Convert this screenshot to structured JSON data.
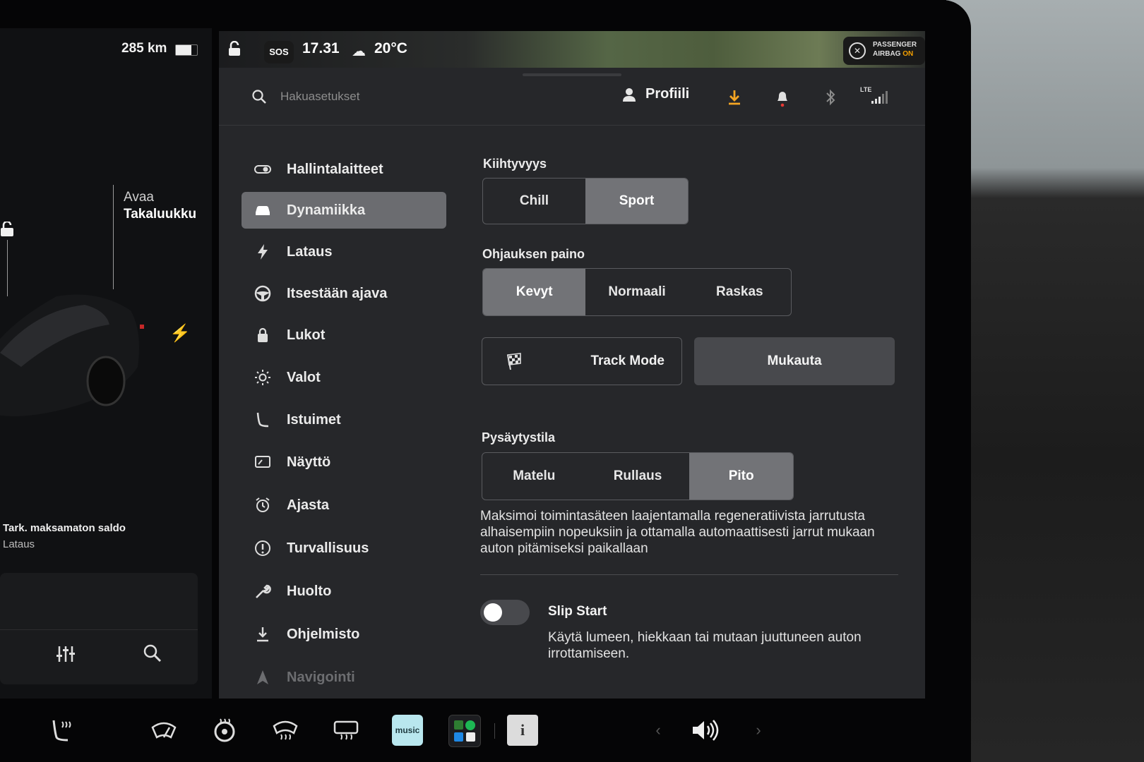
{
  "status_bar": {
    "range": "285 km",
    "battery_level": 0.8,
    "sos_label": "SOS",
    "time": "17.31",
    "temperature": "20°C",
    "airbag_line1": "PASSENGER",
    "airbag_line2a": "AIRBAG",
    "airbag_line2b": "ON"
  },
  "left_panel": {
    "trunk_line1": "Avaa",
    "trunk_line2": "Takaluukku",
    "balance_title": "Tark. maksamaton saldo",
    "balance_sub": "Lataus"
  },
  "header": {
    "search_placeholder": "Hakuasetukset",
    "profile_label": "Profiili",
    "download_color": "#f5a623",
    "notification_dot_color": "#e53935",
    "network_label": "LTE"
  },
  "sidebar": {
    "items": [
      {
        "label": "Hallintalaitteet",
        "icon": "toggle-icon"
      },
      {
        "label": "Dynamiikka",
        "icon": "car-icon",
        "active": true
      },
      {
        "label": "Lataus",
        "icon": "bolt-icon"
      },
      {
        "label": "Itsestään ajava",
        "icon": "steering-wheel-icon"
      },
      {
        "label": "Lukot",
        "icon": "lock-icon"
      },
      {
        "label": "Valot",
        "icon": "sun-icon"
      },
      {
        "label": "Istuimet",
        "icon": "seat-icon"
      },
      {
        "label": "Näyttö",
        "icon": "display-icon"
      },
      {
        "label": "Ajasta",
        "icon": "alarm-icon"
      },
      {
        "label": "Turvallisuus",
        "icon": "alert-icon"
      },
      {
        "label": "Huolto",
        "icon": "wrench-icon"
      },
      {
        "label": "Ohjelmisto",
        "icon": "download-icon"
      },
      {
        "label": "Navigointi",
        "icon": "navigation-icon"
      }
    ]
  },
  "dynamics": {
    "acceleration": {
      "title": "Kiihtyvyys",
      "options": [
        "Chill",
        "Sport"
      ],
      "selected": "Sport"
    },
    "steering": {
      "title": "Ohjauksen paino",
      "options": [
        "Kevyt",
        "Normaali",
        "Raskas"
      ],
      "selected": "Kevyt"
    },
    "track_mode_label": "Track Mode",
    "customize_label": "Mukauta",
    "stopping": {
      "title": "Pysäytystila",
      "options": [
        "Matelu",
        "Rullaus",
        "Pito"
      ],
      "selected": "Pito",
      "description": "Maksimoi toimintasäteen laajentamalla regeneratiivista jarrutusta alhaisempiin nopeuksiin ja ottamalla automaattisesti jarrut mukaan auton pitämiseksi paikallaan"
    },
    "slip_start": {
      "title": "Slip Start",
      "description": "Käytä lumeen, hiekkaan tai mutaan juuttuneen auton irrottamiseen.",
      "enabled": false
    }
  },
  "dock": {
    "amazon_label": "music"
  }
}
